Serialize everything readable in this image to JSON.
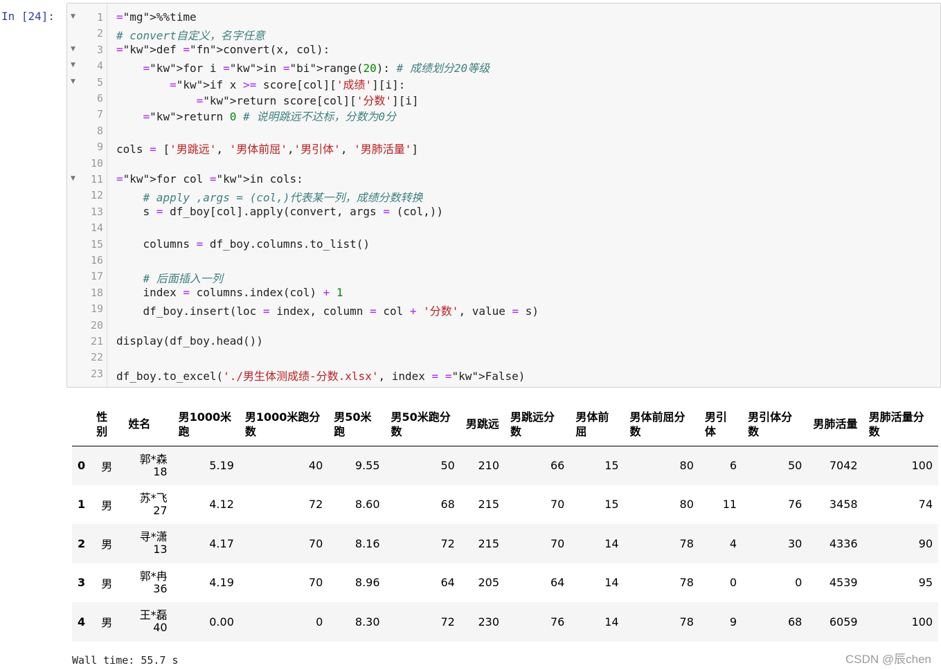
{
  "cell": {
    "prompt": "In  [24]:",
    "code_lines": [
      "%%time",
      "# convert自定义，名字任意",
      "def convert(x, col):",
      "    for i in range(20): # 成绩划分20等级",
      "        if x >= score[col]['成绩'][i]:",
      "            return score[col]['分数'][i]",
      "    return 0 # 说明跳远不达标，分数为0分",
      "",
      "cols = ['男跳远', '男体前屈','男引体', '男肺活量']",
      "",
      "for col in cols:",
      "    # apply ,args = (col,)代表某一列，成绩分数转换",
      "    s = df_boy[col].apply(convert, args = (col,))",
      "",
      "    columns = df_boy.columns.to_list()",
      "",
      "    # 后面插入一列",
      "    index = columns.index(col) + 1",
      "    df_boy.insert(loc = index, column = col + '分数', value = s)",
      "",
      "display(df_boy.head())",
      "",
      "df_boy.to_excel('./男生体测成绩-分数.xlsx', index = False)"
    ]
  },
  "table": {
    "headers": [
      "",
      "性别",
      "姓名",
      "男1000米跑",
      "男1000米跑分数",
      "男50米跑",
      "男50米跑分数",
      "男跳远",
      "男跳远分数",
      "男体前屈",
      "男体前屈分数",
      "男引体",
      "男引体分数",
      "男肺活量",
      "男肺活量分数"
    ],
    "rows": [
      {
        "index": "0",
        "sex": "男",
        "name1": "郭*森",
        "name2": "18",
        "v": [
          "5.19",
          "40",
          "9.55",
          "50",
          "210",
          "66",
          "15",
          "80",
          "6",
          "50",
          "7042",
          "100"
        ]
      },
      {
        "index": "1",
        "sex": "男",
        "name1": "苏*飞",
        "name2": "27",
        "v": [
          "4.12",
          "72",
          "8.60",
          "68",
          "215",
          "70",
          "15",
          "80",
          "11",
          "76",
          "3458",
          "74"
        ]
      },
      {
        "index": "2",
        "sex": "男",
        "name1": "寻*潇",
        "name2": "13",
        "v": [
          "4.17",
          "70",
          "8.16",
          "72",
          "215",
          "70",
          "14",
          "78",
          "4",
          "30",
          "4336",
          "90"
        ]
      },
      {
        "index": "3",
        "sex": "男",
        "name1": "郭*冉",
        "name2": "36",
        "v": [
          "4.19",
          "70",
          "8.96",
          "64",
          "205",
          "64",
          "14",
          "78",
          "0",
          "0",
          "4539",
          "95"
        ]
      },
      {
        "index": "4",
        "sex": "男",
        "name1": "王*磊",
        "name2": "40",
        "v": [
          "0.00",
          "0",
          "8.30",
          "72",
          "230",
          "76",
          "14",
          "78",
          "9",
          "68",
          "6059",
          "100"
        ]
      }
    ]
  },
  "wall_time": "Wall time: 55.7 s",
  "watermark": "CSDN @辰chen"
}
